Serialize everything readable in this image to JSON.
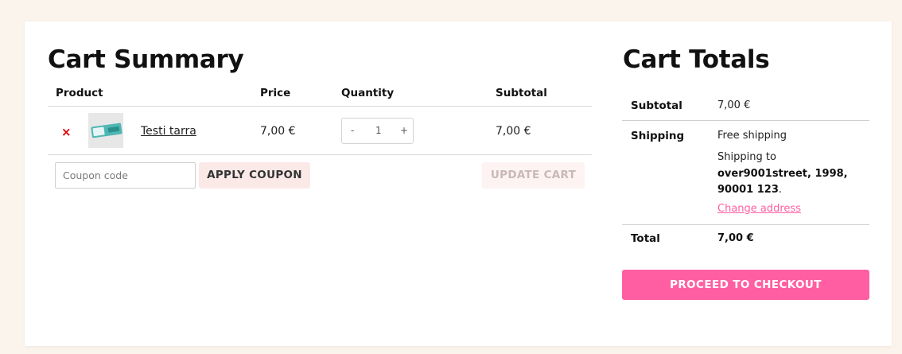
{
  "cart": {
    "title": "Cart Summary",
    "columns": {
      "product": "Product",
      "price": "Price",
      "quantity": "Quantity",
      "subtotal": "Subtotal"
    },
    "item": {
      "remove_symbol": "×",
      "name": "Testi tarra",
      "price": "7,00 €",
      "quantity": "1",
      "decrement": "-",
      "increment": "+",
      "subtotal": "7,00 €"
    },
    "coupon_placeholder": "Coupon code",
    "apply_coupon_label": "APPLY COUPON",
    "update_cart_label": "UPDATE CART"
  },
  "totals": {
    "title": "Cart Totals",
    "subtotal_label": "Subtotal",
    "subtotal_value": "7,00 €",
    "shipping_label": "Shipping",
    "shipping_method": "Free shipping",
    "shipping_to_prefix": "Shipping to",
    "shipping_address": "over9001street, 1998, 90001 123",
    "shipping_address_suffix": ".",
    "change_address_label": "Change address",
    "total_label": "Total",
    "total_value": "7,00 €",
    "checkout_label": "PROCEED TO CHECKOUT"
  },
  "colors": {
    "page_background": "#fbf4ec",
    "accent": "#ff5fa2",
    "remove": "#e00000",
    "coupon_button": "#fbe9e8"
  },
  "icons": {
    "remove": "close-icon",
    "thumbnail": "product-thumbnail"
  }
}
